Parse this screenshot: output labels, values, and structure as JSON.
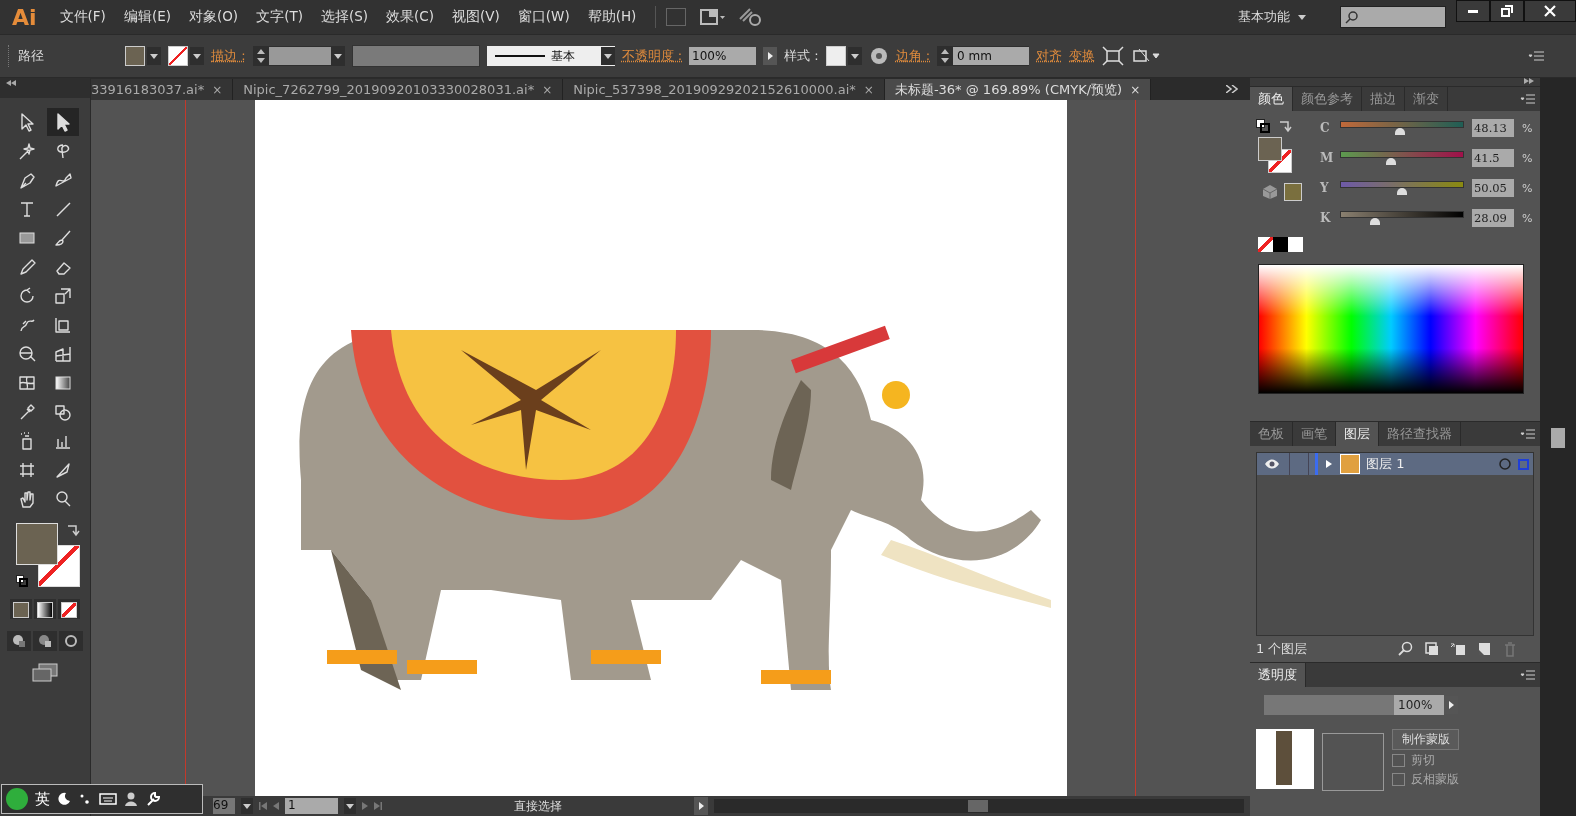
{
  "app": {
    "logo": "Ai"
  },
  "menu": [
    "文件(F)",
    "编辑(E)",
    "对象(O)",
    "文字(T)",
    "选择(S)",
    "效果(C)",
    "视图(V)",
    "窗口(W)",
    "帮助(H)"
  ],
  "workspace": {
    "label": "基本功能"
  },
  "control_bar": {
    "object_type": "路径",
    "stroke_label": "描边 :",
    "stroke_style": "基本",
    "opacity_label": "不透明度 :",
    "opacity": "100%",
    "style_label": "样式 :",
    "corner_label": "边角 :",
    "corner_value": "0 mm",
    "align": "对齐",
    "transform": "变换"
  },
  "tabs": [
    {
      "label": "33916183037.ai*",
      "close": "×",
      "selected": false
    },
    {
      "label": "Nipic_7262799_20190920103330028031.ai*",
      "close": "×",
      "selected": false
    },
    {
      "label": "Nipic_537398_20190929202152610000.ai*",
      "close": "×",
      "selected": false
    },
    {
      "label": "未标题-36* @ 169.89% (CMYK/预览)",
      "close": "×",
      "selected": true
    }
  ],
  "tools": [
    {
      "kind": "select",
      "selected": false
    },
    {
      "kind": "direct",
      "selected": true
    },
    {
      "kind": "wand",
      "selected": false
    },
    {
      "kind": "lasso",
      "selected": false
    },
    {
      "kind": "pen",
      "selected": false
    },
    {
      "kind": "curvature",
      "selected": false
    },
    {
      "kind": "type",
      "selected": false
    },
    {
      "kind": "line",
      "selected": false
    },
    {
      "kind": "rect",
      "selected": false
    },
    {
      "kind": "brush",
      "selected": false
    },
    {
      "kind": "pencil",
      "selected": false
    },
    {
      "kind": "eraser",
      "selected": false
    },
    {
      "kind": "rotate",
      "selected": false
    },
    {
      "kind": "scale",
      "selected": false
    },
    {
      "kind": "warp",
      "selected": false
    },
    {
      "kind": "freetransform",
      "selected": false
    },
    {
      "kind": "shapebuilder",
      "selected": false
    },
    {
      "kind": "perspective",
      "selected": false
    },
    {
      "kind": "mesh",
      "selected": false
    },
    {
      "kind": "gradient",
      "selected": false
    },
    {
      "kind": "eyedropper",
      "selected": false
    },
    {
      "kind": "blend",
      "selected": false
    },
    {
      "kind": "spray",
      "selected": false
    },
    {
      "kind": "graph",
      "selected": false
    },
    {
      "kind": "artboard",
      "selected": false
    },
    {
      "kind": "slice",
      "selected": false
    },
    {
      "kind": "hand",
      "selected": false
    },
    {
      "kind": "zoom",
      "selected": false
    }
  ],
  "color_panel": {
    "tabs": [
      {
        "label": "颜色",
        "selected": true
      },
      {
        "label": "颜色参考",
        "selected": false
      },
      {
        "label": "描边",
        "selected": false
      },
      {
        "label": "渐变",
        "selected": false
      }
    ],
    "sliders": [
      {
        "channel": "C",
        "level": 0.48,
        "value": "48.13",
        "unit": "%"
      },
      {
        "channel": "M",
        "level": 0.415,
        "value": "41.5",
        "unit": "%"
      },
      {
        "channel": "Y",
        "level": 0.5,
        "value": "50.05",
        "unit": "%"
      },
      {
        "channel": "K",
        "level": 0.28,
        "value": "28.09",
        "unit": "%"
      }
    ]
  },
  "layers_panel": {
    "tabs": [
      {
        "label": "色板",
        "selected": false
      },
      {
        "label": "画笔",
        "selected": false
      },
      {
        "label": "图层",
        "selected": true
      },
      {
        "label": "路径查找器",
        "selected": false
      }
    ],
    "layers": [
      {
        "name": "图层 1",
        "visible": true,
        "expanded": false
      }
    ],
    "count": "1 个图层"
  },
  "transparency_panel": {
    "title": "透明度",
    "opacity": "100%",
    "make_mask": "制作蒙版",
    "options": [
      {
        "label": "剪切",
        "checked": false
      },
      {
        "label": "反相蒙版",
        "checked": false
      }
    ]
  },
  "status_bar": {
    "zoom": "69",
    "page": "1",
    "tool": "直接选择"
  },
  "ime_bar": {
    "language": "英"
  }
}
